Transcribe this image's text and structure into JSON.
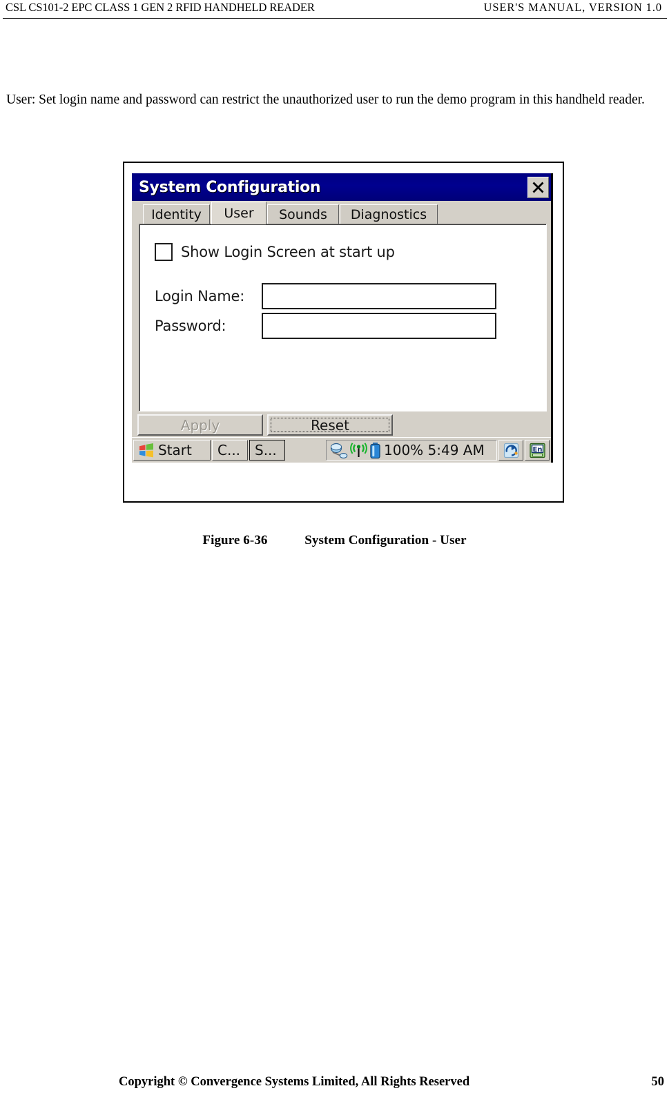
{
  "header": {
    "left": "CSL CS101-2 EPC CLASS 1 GEN 2 RFID HANDHELD READER",
    "right": "USER'S  MANUAL,  VERSION  1.0"
  },
  "body": {
    "paragraph": "User: Set login name and password can restrict the unauthorized user to run the demo program in this handheld reader."
  },
  "figure": {
    "caption_number": "Figure 6-36",
    "caption_title": "System Configuration - User",
    "screenshot": {
      "window": {
        "title": "System Configuration",
        "close_icon": "close-icon",
        "titlebar_color": "#000082"
      },
      "tabs": [
        {
          "label": "Identity",
          "active": false
        },
        {
          "label": "User",
          "active": true
        },
        {
          "label": "Sounds",
          "active": false
        },
        {
          "label": "Diagnostics",
          "active": false
        }
      ],
      "form": {
        "checkbox": {
          "label": "Show Login Screen at start up",
          "checked": false
        },
        "fields": [
          {
            "label": "Login Name:",
            "value": "",
            "placeholder": ""
          },
          {
            "label": "Password:",
            "value": "",
            "placeholder": ""
          }
        ]
      },
      "buttons": [
        {
          "label": "Apply",
          "enabled": false,
          "focused": false
        },
        {
          "label": "Reset",
          "enabled": true,
          "focused": true
        }
      ],
      "taskbar": {
        "start_label": "Start",
        "start_icon": "windows-flag-icon",
        "task_buttons": [
          {
            "label": "C...",
            "active": false
          },
          {
            "label": "S...",
            "active": true
          }
        ],
        "tray": {
          "icons": [
            "network-connection-icon",
            "wireless-signal-icon",
            "battery-icon"
          ],
          "status_text": "100% 5:49 AM",
          "battery_percent": "100%",
          "clock": "5:49 AM"
        },
        "right_icons": [
          "refresh-rotate-icon",
          "input-language-en-icon"
        ]
      }
    }
  },
  "footer": {
    "copyright": "Copyright © Convergence Systems Limited, All Rights Reserved",
    "page_number": "50"
  }
}
